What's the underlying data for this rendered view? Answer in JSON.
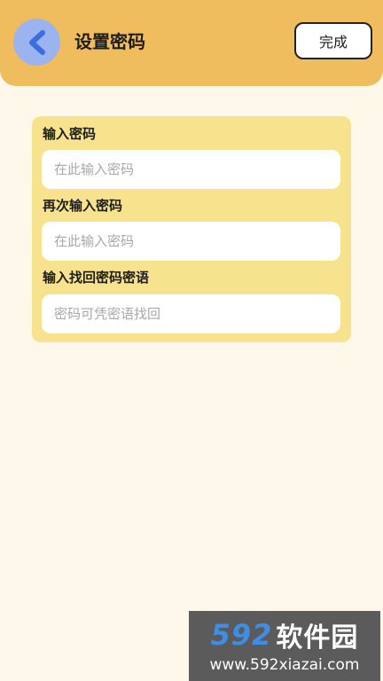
{
  "header": {
    "title": "设置密码",
    "back_icon": "chevron-left-icon",
    "done_label": "完成"
  },
  "form": {
    "fields": [
      {
        "label": "输入密码",
        "placeholder": "在此输入密码"
      },
      {
        "label": "再次输入密码",
        "placeholder": "在此输入密码"
      },
      {
        "label": "输入找回密码密语",
        "placeholder": "密码可凭密语找回"
      }
    ]
  },
  "watermark": {
    "brand_number": "592",
    "brand_text": "软件园",
    "url": "www.592xiazai.com"
  },
  "colors": {
    "background": "#fdf8ea",
    "header": "#f0bd5e",
    "back_button": "#9bb3ef",
    "back_arrow": "#3b6fe0",
    "card": "#f7e38e"
  }
}
